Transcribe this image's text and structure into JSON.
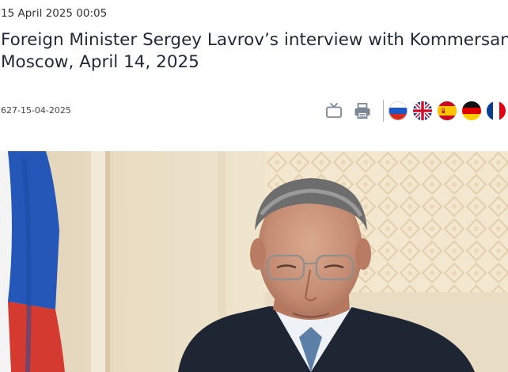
{
  "article": {
    "date": "15 April 2025 00:05",
    "title_line1": "Foreign Minister Sergey Lavrov’s interview with Kommersant,",
    "title_line2": "Moscow, April 14, 2025",
    "doc_number": "627-15-04-2025"
  },
  "toolbar": {
    "icons": [
      "tv-icon",
      "print-icon"
    ],
    "languages": [
      "Russian",
      "English",
      "Spanish",
      "German",
      "French"
    ]
  },
  "colors": {
    "icon_gray": "#7b8794",
    "title": "#1f2a36"
  }
}
